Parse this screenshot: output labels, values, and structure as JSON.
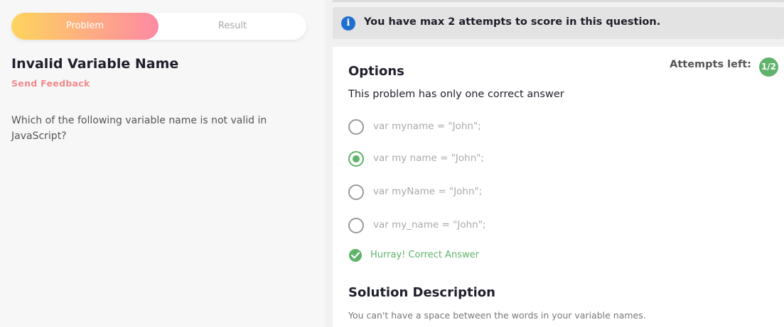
{
  "tabs": {
    "problem": "Problem",
    "result": "Result"
  },
  "question": {
    "title": "Invalid Variable Name",
    "feedback": "Send Feedback",
    "text": "Which of the following variable name is not valid in JavaScript?"
  },
  "banner": {
    "icon": "info-icon",
    "text": "You have max 2 attempts to score in this question."
  },
  "options_section": {
    "title": "Options",
    "attempts_label": "Attempts left:",
    "attempts_value": "1/2",
    "subtitle": "This problem has only one correct answer",
    "options": [
      {
        "label": "var myname = \"John\";",
        "selected": false
      },
      {
        "label": "var my name = \"John\";",
        "selected": true
      },
      {
        "label": "var myName = \"John\";",
        "selected": false
      },
      {
        "label": "var my_name = \"John\";",
        "selected": false
      }
    ],
    "result_icon": "check-circle-icon",
    "result_text": "Hurray! Correct Answer"
  },
  "solution": {
    "title": "Solution Description",
    "text": "You can't have a space between the words in your variable names."
  },
  "colors": {
    "accent_green": "#5fb36b",
    "info_blue": "#1f6fd1",
    "tab_gradient_start": "#fed45d",
    "tab_gradient_end": "#fd8aa3",
    "feedback_pink": "#f28a8a"
  }
}
